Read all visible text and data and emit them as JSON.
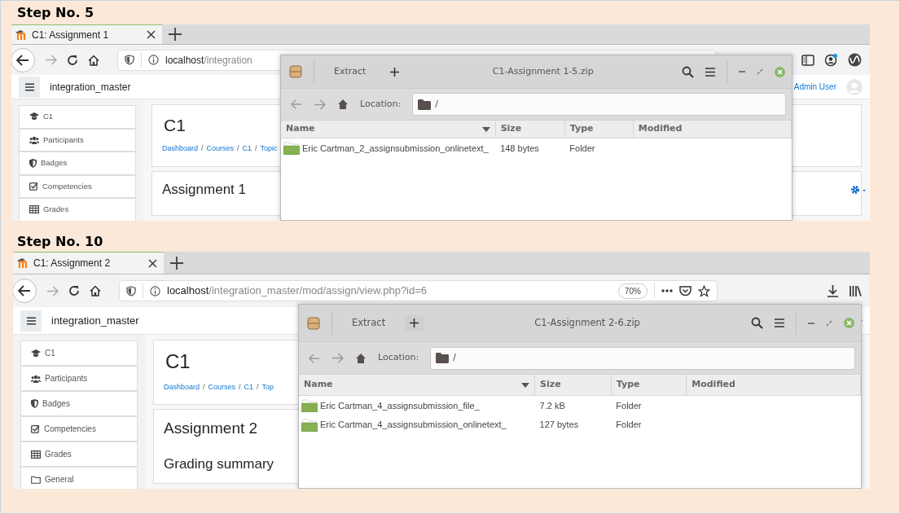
{
  "steps": [
    {
      "label": "Step No. 5",
      "browser": {
        "tab_title": "C1: Assignment 1",
        "url_host": "localhost",
        "url_path": "/integration"
      },
      "site": {
        "name": "integration_master",
        "user": "Admin User"
      },
      "nav": [
        {
          "label": "C1"
        },
        {
          "label": "Participants"
        },
        {
          "label": "Badges"
        },
        {
          "label": "Competencies"
        },
        {
          "label": "Grades"
        }
      ],
      "course": {
        "title": "C1",
        "breadcrumb": [
          {
            "label": "Dashboard",
            "separator": "/"
          },
          {
            "label": "Courses",
            "separator": "/"
          },
          {
            "label": "C1",
            "separator": "/"
          },
          {
            "label": "Topic"
          }
        ]
      },
      "activity": {
        "title": "Assignment 1"
      },
      "archive": {
        "button": "Extract",
        "title": "C1-Assignment 1-5.zip",
        "location_label": "Location:",
        "location": "/",
        "columns": [
          "Name",
          "Size",
          "Type",
          "Modified"
        ],
        "rows": [
          {
            "name": "Eric Cartman_2_assignsubmission_onlinetext_",
            "size": "148 bytes",
            "type": "Folder"
          }
        ]
      }
    },
    {
      "label": "Step No. 10",
      "browser": {
        "tab_title": "C1: Assignment 2",
        "url_host": "localhost",
        "url_path": "/integration_master/mod/assign/view.php?id=6",
        "zoom": "70%"
      },
      "site": {
        "name": "integration_master"
      },
      "nav": [
        {
          "label": "C1"
        },
        {
          "label": "Participants"
        },
        {
          "label": "Badges"
        },
        {
          "label": "Competencies"
        },
        {
          "label": "Grades"
        },
        {
          "label": "General"
        }
      ],
      "course": {
        "title": "C1",
        "breadcrumb": [
          {
            "label": "Dashboard",
            "separator": "/"
          },
          {
            "label": "Courses",
            "separator": "/"
          },
          {
            "label": "C1",
            "separator": "/"
          },
          {
            "label": "Top"
          }
        ]
      },
      "activity": {
        "title": "Assignment 2",
        "subtitle": "Grading summary"
      },
      "archive": {
        "button": "Extract",
        "title": "C1-Assignment 2-6.zip",
        "location_label": "Location:",
        "location": "/",
        "columns": [
          "Name",
          "Size",
          "Type",
          "Modified"
        ],
        "rows": [
          {
            "name": "Eric Cartman_4_assignsubmission_file_",
            "size": "7.2 kB",
            "type": "Folder"
          },
          {
            "name": "Eric Cartman_4_assignsubmission_onlinetext_",
            "size": "127 bytes",
            "type": "Folder"
          }
        ]
      }
    }
  ]
}
